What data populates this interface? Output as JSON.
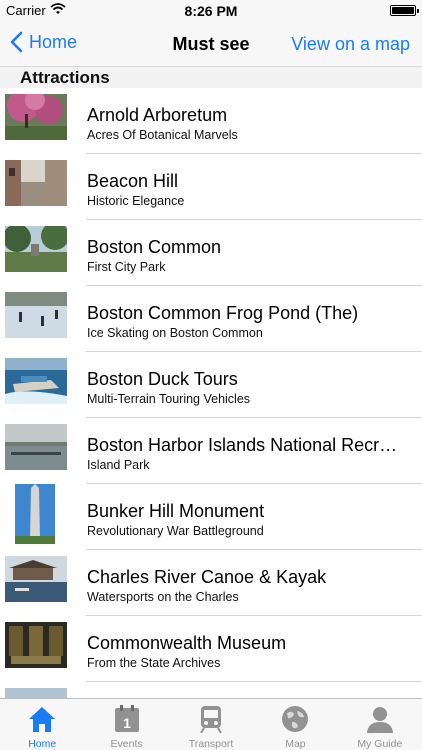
{
  "status": {
    "carrier": "Carrier",
    "time": "8:26 PM"
  },
  "nav": {
    "back_label": "Home",
    "title": "Must see",
    "right_label": "View on a map"
  },
  "section": {
    "header": "Attractions"
  },
  "items": [
    {
      "title": "Arnold Arboretum",
      "subtitle": "Acres Of Botanical Marvels"
    },
    {
      "title": "Beacon Hill",
      "subtitle": "Historic Elegance"
    },
    {
      "title": "Boston Common",
      "subtitle": "First City Park"
    },
    {
      "title": "Boston Common Frog Pond (The)",
      "subtitle": "Ice Skating on Boston Common"
    },
    {
      "title": "Boston Duck Tours",
      "subtitle": "Multi-Terrain Touring Vehicles"
    },
    {
      "title": "Boston Harbor Islands National Recreation Area",
      "subtitle": "Island Park"
    },
    {
      "title": "Bunker Hill Monument",
      "subtitle": "Revolutionary War Battleground"
    },
    {
      "title": "Charles River Canoe & Kayak",
      "subtitle": "Watersports on the Charles"
    },
    {
      "title": "Commonwealth Museum",
      "subtitle": "From the State Archives"
    }
  ],
  "tabs": [
    {
      "label": "Home",
      "icon": "home-icon",
      "active": true
    },
    {
      "label": "Events",
      "icon": "calendar-icon"
    },
    {
      "label": "Transport",
      "icon": "train-icon"
    },
    {
      "label": "Map",
      "icon": "globe-icon"
    },
    {
      "label": "My Guide",
      "icon": "person-icon"
    }
  ],
  "colors": {
    "accent": "#1a7cf5",
    "tab_inactive": "#929292"
  }
}
